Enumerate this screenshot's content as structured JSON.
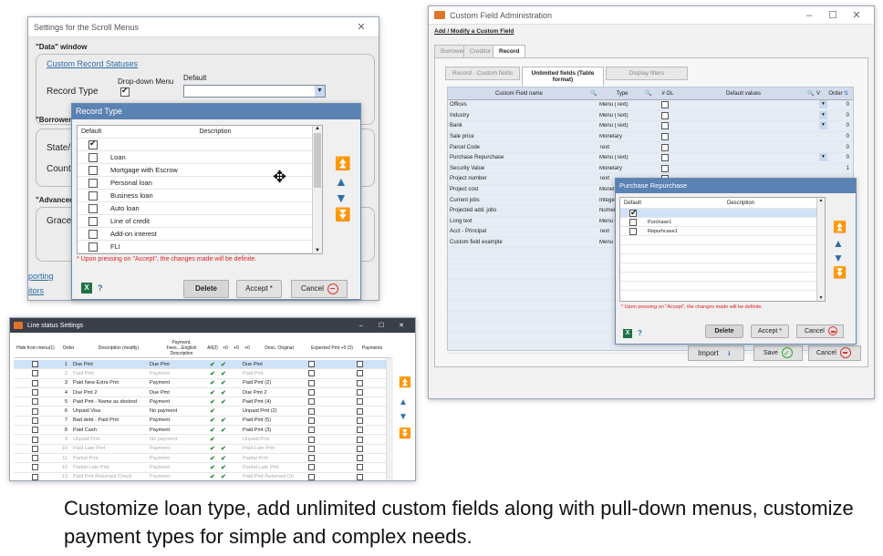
{
  "caption": "Customize loan type, add unlimited custom fields along with pull-down menus, customize payment types for simple and complex needs.",
  "scroll_settings": {
    "title": "Settings for the Scroll Menus",
    "data_window_label": "\"Data\" window",
    "custom_record_statuses": "Custom Record Statuses",
    "record_type_label": "Record Type",
    "dropdown_menu_label": "Drop-down Menu",
    "default_label": "Default",
    "borrower_label": "\"Borrower\"",
    "state_label": "State/P",
    "country_label": "Countr",
    "advanced_label": "\"Advanced\"",
    "grace_label": "Grace p",
    "side_link_1": "porting",
    "side_link_2": "itors"
  },
  "record_type_dialog": {
    "title": "Record Type",
    "col_default": "Default",
    "col_description": "Description",
    "items": [
      "",
      "Loan",
      "Mortgage with Escrow",
      "Personal loan",
      "Business loan",
      "Auto loan",
      "Line of credit",
      "Add-on interest",
      "FLI"
    ],
    "warning": "* Upon pressing on \"Accept\", the changes made will be definite.",
    "delete": "Delete",
    "accept": "Accept *",
    "cancel": "Cancel",
    "help": "?"
  },
  "custom_field_admin": {
    "title": "Custom Field Administration",
    "add_modify": "Add / Modify a Custom Field",
    "tabs": [
      "Borrower",
      "Creditor",
      "Record"
    ],
    "subtabs": [
      "Record - Custom fields",
      "Unlimited fields (Table format)",
      "Display filters"
    ],
    "col_name": "Custom Field name",
    "col_type": "Type",
    "col_gl": "# GL",
    "col_default": "Default values",
    "col_v": "V",
    "col_order": "Order",
    "rows": [
      {
        "name": "Offices",
        "type": "Menu (Text)",
        "order": "0"
      },
      {
        "name": "Industry",
        "type": "Menu (Text)",
        "order": "0"
      },
      {
        "name": "Bank",
        "type": "Menu (Text)",
        "order": "0"
      },
      {
        "name": "Sale price",
        "type": "Monetary",
        "order": "0"
      },
      {
        "name": "Parcel Code",
        "type": "Text",
        "order": "0"
      },
      {
        "name": "Purchase Repurchase",
        "type": "Menu (Text)",
        "order": "0"
      },
      {
        "name": "Security Value",
        "type": "Monetary",
        "order": "1"
      },
      {
        "name": "Project number",
        "type": "Text",
        "order": ""
      },
      {
        "name": "Project cost",
        "type": "Monet",
        "order": ""
      },
      {
        "name": "Current jobs",
        "type": "Integer",
        "order": ""
      },
      {
        "name": "Projected add. jobs",
        "type": "Numer",
        "order": ""
      },
      {
        "name": "Long text",
        "type": "Menu",
        "order": ""
      },
      {
        "name": "Acct - Principal",
        "type": "Text",
        "order": ""
      },
      {
        "name": "Custom field example",
        "type": "Menu",
        "order": ""
      }
    ],
    "import": "Import",
    "save": "Save",
    "cancel": "Cancel"
  },
  "purchase_dialog": {
    "title": "Purchase Repurchase",
    "col_default": "Default",
    "col_description": "Description",
    "items": [
      "",
      "Purchase1",
      "Repurhcase1"
    ],
    "warning": "* Upon pressing on \"Accept\", the changes made will be definite.",
    "delete": "Delete",
    "accept": "Accept *",
    "cancel": "Cancel",
    "help": "?"
  },
  "line_status": {
    "title": "Line status Settings",
    "headers": [
      "Hide from menu(1)",
      "Order",
      "Description (modify)",
      "Payment, Fees....English Description",
      "All(2)",
      "+0",
      "+0",
      "+0",
      "Desc. Original",
      "Expected Pmt +0 (3)",
      "Payments"
    ],
    "rows": [
      {
        "order": "1",
        "desc": "Due Pmt",
        "pay": "Due Pmt",
        "orig": "Due Pmt",
        "c1": true,
        "c2": true,
        "dim": false,
        "sel": true
      },
      {
        "order": "2",
        "desc": "Paid Pmt",
        "pay": "Payment",
        "orig": "Paid Pmt",
        "c1": true,
        "c2": true,
        "dim": true,
        "sel": false
      },
      {
        "order": "3",
        "desc": "Paid New Extra Pmt",
        "pay": "Payment",
        "orig": "Paid Pmt (2)",
        "c1": true,
        "c2": true,
        "dim": false,
        "sel": false
      },
      {
        "order": "4",
        "desc": "Due Pmt 2",
        "pay": "Due Pmt",
        "orig": "Due Pmt 2",
        "c1": true,
        "c2": true,
        "dim": false,
        "sel": false
      },
      {
        "order": "5",
        "desc": "Paid Pmt - Name as desired",
        "pay": "Payment",
        "orig": "Paid Pmt (4)",
        "c1": true,
        "c2": true,
        "dim": false,
        "sel": false
      },
      {
        "order": "6",
        "desc": "Unpaid Visa",
        "pay": "No payment",
        "orig": "Unpaid Pmt (2)",
        "c1": true,
        "c2": false,
        "dim": false,
        "sel": false
      },
      {
        "order": "7",
        "desc": "Bad debt - Paid Pmt",
        "pay": "Payment",
        "orig": "Paid Pmt (5)",
        "c1": true,
        "c2": true,
        "dim": false,
        "sel": false
      },
      {
        "order": "8",
        "desc": "Paid Cash",
        "pay": "Payment",
        "orig": "Paid Pmt (3)",
        "c1": true,
        "c2": true,
        "dim": false,
        "sel": false
      },
      {
        "order": "9",
        "desc": "Unpaid Pmt",
        "pay": "No payment",
        "orig": "Unpaid Pmt",
        "c1": true,
        "c2": false,
        "dim": true,
        "sel": false
      },
      {
        "order": "10",
        "desc": "Paid Late Pmt",
        "pay": "Payment",
        "orig": "Paid Late Pmt",
        "c1": true,
        "c2": true,
        "dim": true,
        "sel": false
      },
      {
        "order": "11",
        "desc": "Partial Pmt",
        "pay": "Payment",
        "orig": "Partial Pmt",
        "c1": true,
        "c2": true,
        "dim": true,
        "sel": false
      },
      {
        "order": "12",
        "desc": "Partial Late Pmt",
        "pay": "Payment",
        "orig": "Partial Late Pmt",
        "c1": true,
        "c2": true,
        "dim": true,
        "sel": false
      },
      {
        "order": "13",
        "desc": "Paid Pmt Returned Check",
        "pay": "Payment",
        "orig": "Paid Pmt Returned Ch",
        "c1": true,
        "c2": true,
        "dim": true,
        "sel": false
      }
    ]
  }
}
